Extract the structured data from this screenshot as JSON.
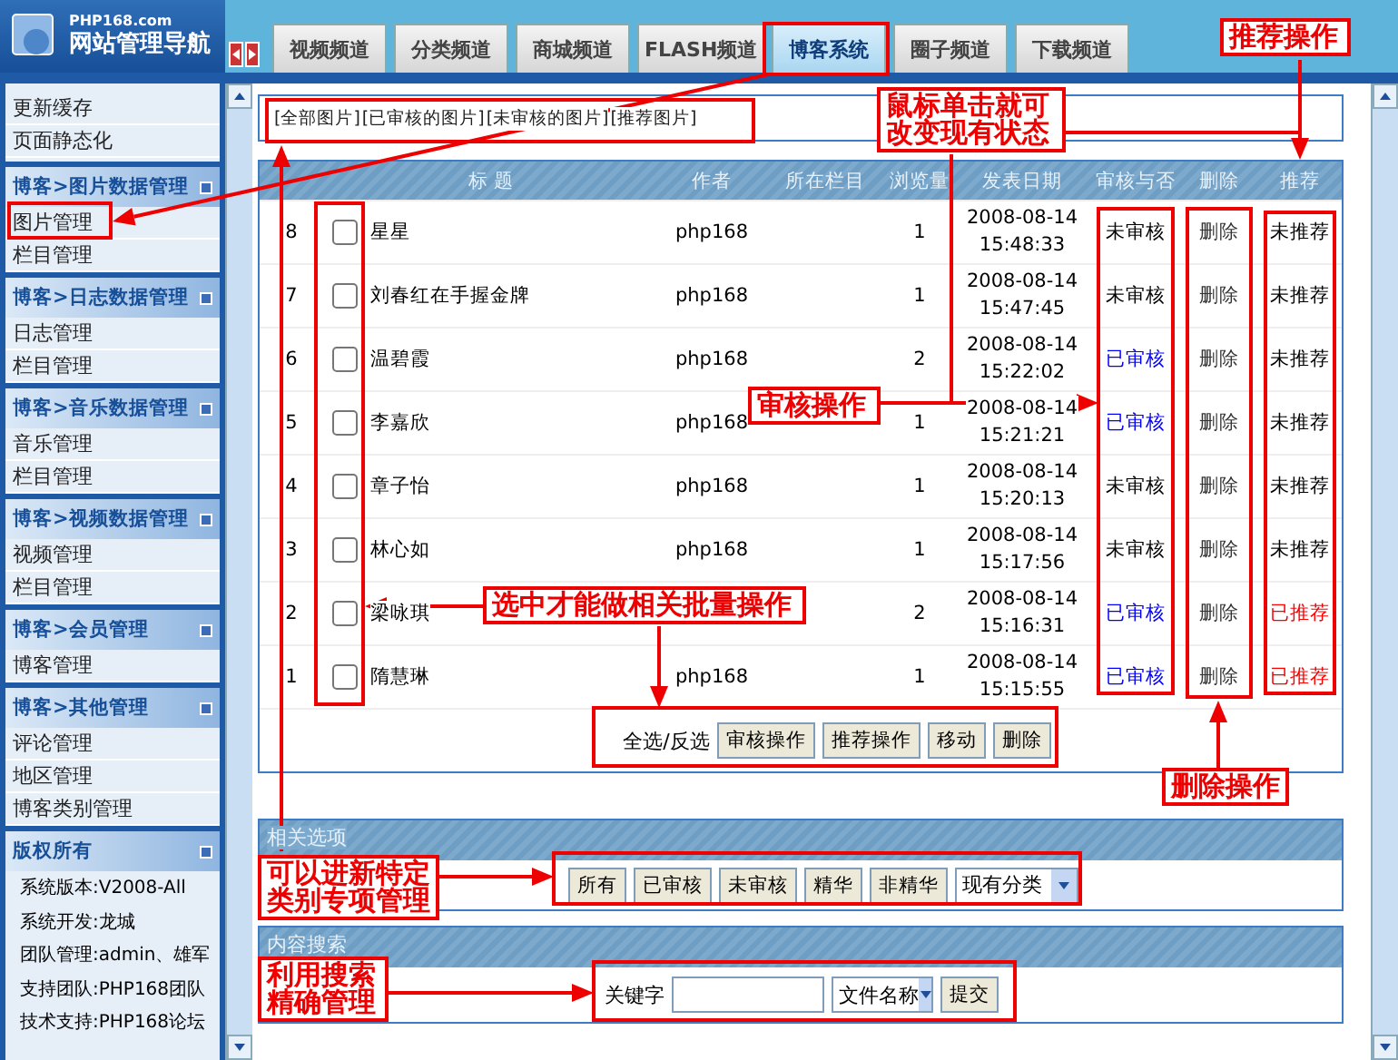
{
  "logo": {
    "site": "PHP168.com",
    "title": "网站管理导航"
  },
  "tabs": [
    {
      "label": "视频频道",
      "selected": false
    },
    {
      "label": "分类频道",
      "selected": false
    },
    {
      "label": "商城频道",
      "selected": false
    },
    {
      "label": "FLASH频道",
      "selected": false
    },
    {
      "label": "博客系统",
      "selected": true
    },
    {
      "label": "圈子频道",
      "selected": false
    },
    {
      "label": "下载频道",
      "selected": false
    }
  ],
  "sidebar": {
    "groups": [
      {
        "items": [
          {
            "label": "更新缓存"
          },
          {
            "label": "页面静态化"
          }
        ]
      },
      {
        "title": "博客>图片数据管理",
        "items": [
          {
            "label": "图片管理"
          },
          {
            "label": "栏目管理"
          }
        ]
      },
      {
        "title": "博客>日志数据管理",
        "items": [
          {
            "label": "日志管理"
          },
          {
            "label": "栏目管理"
          }
        ]
      },
      {
        "title": "博客>音乐数据管理",
        "items": [
          {
            "label": "音乐管理"
          },
          {
            "label": "栏目管理"
          }
        ]
      },
      {
        "title": "博客>视频数据管理",
        "items": [
          {
            "label": "视频管理"
          },
          {
            "label": "栏目管理"
          }
        ]
      },
      {
        "title": "博客>会员管理",
        "items": [
          {
            "label": "博客管理"
          }
        ]
      },
      {
        "title": "博客>其他管理",
        "items": [
          {
            "label": "评论管理"
          },
          {
            "label": "地区管理"
          },
          {
            "label": "博客类别管理"
          }
        ]
      }
    ],
    "copyright": {
      "title": "版权所有",
      "lines": [
        "系统版本:V2008-All",
        "系统开发:龙城",
        "团队管理:admin、雄军",
        "支持团队:PHP168团队",
        "技术支持:PHP168论坛"
      ]
    }
  },
  "filter_links": [
    "[全部图片]",
    "[已审核的图片]",
    "[未审核的图片]",
    "[推荐图片]"
  ],
  "table": {
    "columns": [
      "",
      "标 题",
      "作者",
      "所在栏目",
      "浏览量",
      "发表日期",
      "审核与否",
      "删除",
      "推荐"
    ],
    "rows": [
      {
        "id": "8",
        "checked": false,
        "title": "星星",
        "author": "php168",
        "views": "1",
        "date": "2008-08-14",
        "time": "15:48:33",
        "status": "未审核",
        "approved": false,
        "delete": "删除",
        "recommend": "未推荐",
        "recommended": false
      },
      {
        "id": "7",
        "checked": false,
        "title": "刘春红在手握金牌",
        "author": "php168",
        "views": "1",
        "date": "2008-08-14",
        "time": "15:47:45",
        "status": "未审核",
        "approved": false,
        "delete": "删除",
        "recommend": "未推荐",
        "recommended": false
      },
      {
        "id": "6",
        "checked": false,
        "title": "温碧霞",
        "author": "php168",
        "views": "2",
        "date": "2008-08-14",
        "time": "15:22:02",
        "status": "已审核",
        "approved": true,
        "delete": "删除",
        "recommend": "未推荐",
        "recommended": false
      },
      {
        "id": "5",
        "checked": false,
        "title": "李嘉欣",
        "author": "php168",
        "views": "1",
        "date": "2008-08-14",
        "time": "15:21:21",
        "status": "已审核",
        "approved": true,
        "delete": "删除",
        "recommend": "未推荐",
        "recommended": false
      },
      {
        "id": "4",
        "checked": false,
        "title": "章子怡",
        "author": "php168",
        "views": "1",
        "date": "2008-08-14",
        "time": "15:20:13",
        "status": "未审核",
        "approved": false,
        "delete": "删除",
        "recommend": "未推荐",
        "recommended": false
      },
      {
        "id": "3",
        "checked": false,
        "title": "林心如",
        "author": "php168",
        "views": "1",
        "date": "2008-08-14",
        "time": "15:17:56",
        "status": "未审核",
        "approved": false,
        "delete": "删除",
        "recommend": "未推荐",
        "recommended": false
      },
      {
        "id": "2",
        "checked": false,
        "title": "梁咏琪",
        "views": "2",
        "date": "2008-08-14",
        "time": "15:16:31",
        "status": "已审核",
        "approved": true,
        "delete": "删除",
        "recommend": "已推荐",
        "recommended": true
      },
      {
        "id": "1",
        "checked": false,
        "title": "隋慧琳",
        "author": "php168",
        "views": "1",
        "date": "2008-08-14",
        "time": "15:15:55",
        "status": "已审核",
        "approved": true,
        "delete": "删除",
        "recommend": "已推荐",
        "recommended": true
      }
    ],
    "select_all": "全选/反选",
    "actions": [
      "审核操作",
      "推荐操作",
      "移动",
      "删除"
    ]
  },
  "options": {
    "title": "相关选项",
    "buttons": [
      "所有",
      "已审核",
      "未审核",
      "精华",
      "非精华"
    ],
    "category_select": "现有分类"
  },
  "search": {
    "title": "内容搜索",
    "label": "关键字",
    "field_select": "文件名称",
    "submit": "提交"
  },
  "annotations": [
    "推荐操作",
    "鼠标单击就可改变现有状态",
    "审核操作",
    "选中才能做相关批量操作",
    "删除操作",
    "可以进新特定类别专项管理",
    "利用搜索精确管理"
  ]
}
